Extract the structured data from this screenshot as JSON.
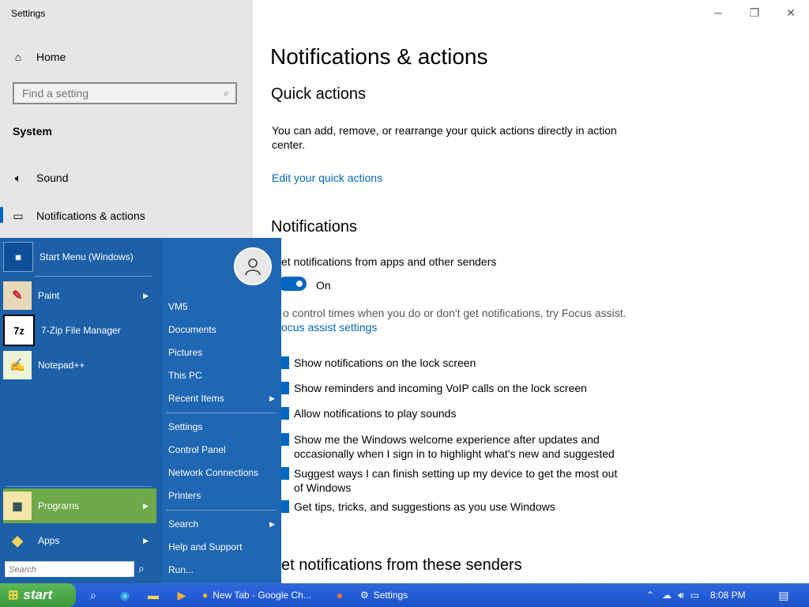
{
  "window": {
    "title": "Settings"
  },
  "sidebar": {
    "home": "Home",
    "search_placeholder": "Find a setting",
    "section": "System",
    "items": [
      {
        "label": "Sound"
      },
      {
        "label": "Notifications & actions"
      }
    ]
  },
  "content": {
    "title": "Notifications & actions",
    "quick_actions": {
      "heading": "Quick actions",
      "text": "You can add, remove, or rearrange your quick actions directly in action center.",
      "link": "Edit your quick actions"
    },
    "notifications": {
      "heading": "Notifications",
      "get_label": "et notifications from apps and other senders",
      "toggle_state": "On",
      "focus_text": "o control times when you do or don't get notifications, try Focus assist.",
      "focus_link": "ocus assist settings",
      "checks": [
        "Show notifications on the lock screen",
        "Show reminders and incoming VoIP calls on the lock screen",
        "Allow notifications to play sounds",
        "Show me the Windows welcome experience after updates and occasionally when I sign in to highlight what's new and suggested",
        "Suggest ways I can finish setting up my device to get the most out of Windows",
        "Get tips, tricks, and suggestions as you use Windows"
      ],
      "senders_heading": "et notifications from these senders"
    }
  },
  "start_menu": {
    "left": {
      "pinned": "Start Menu (Windows)",
      "items": [
        "Paint",
        "7-Zip File Manager",
        "Notepad++"
      ],
      "programs": "Programs",
      "apps": "Apps",
      "search_placeholder": "Search"
    },
    "right": {
      "items_a": [
        "VM5",
        "Documents",
        "Pictures",
        "This PC",
        "Recent Items"
      ],
      "items_b": [
        "Settings",
        "Control Panel",
        "Network Connections",
        "Printers"
      ],
      "items_c": [
        "Search",
        "Help and Support",
        "Run..."
      ]
    }
  },
  "taskbar": {
    "start": "start",
    "chrome": "New Tab - Google Ch...",
    "settings": "Settings",
    "time": "8:08 PM"
  }
}
